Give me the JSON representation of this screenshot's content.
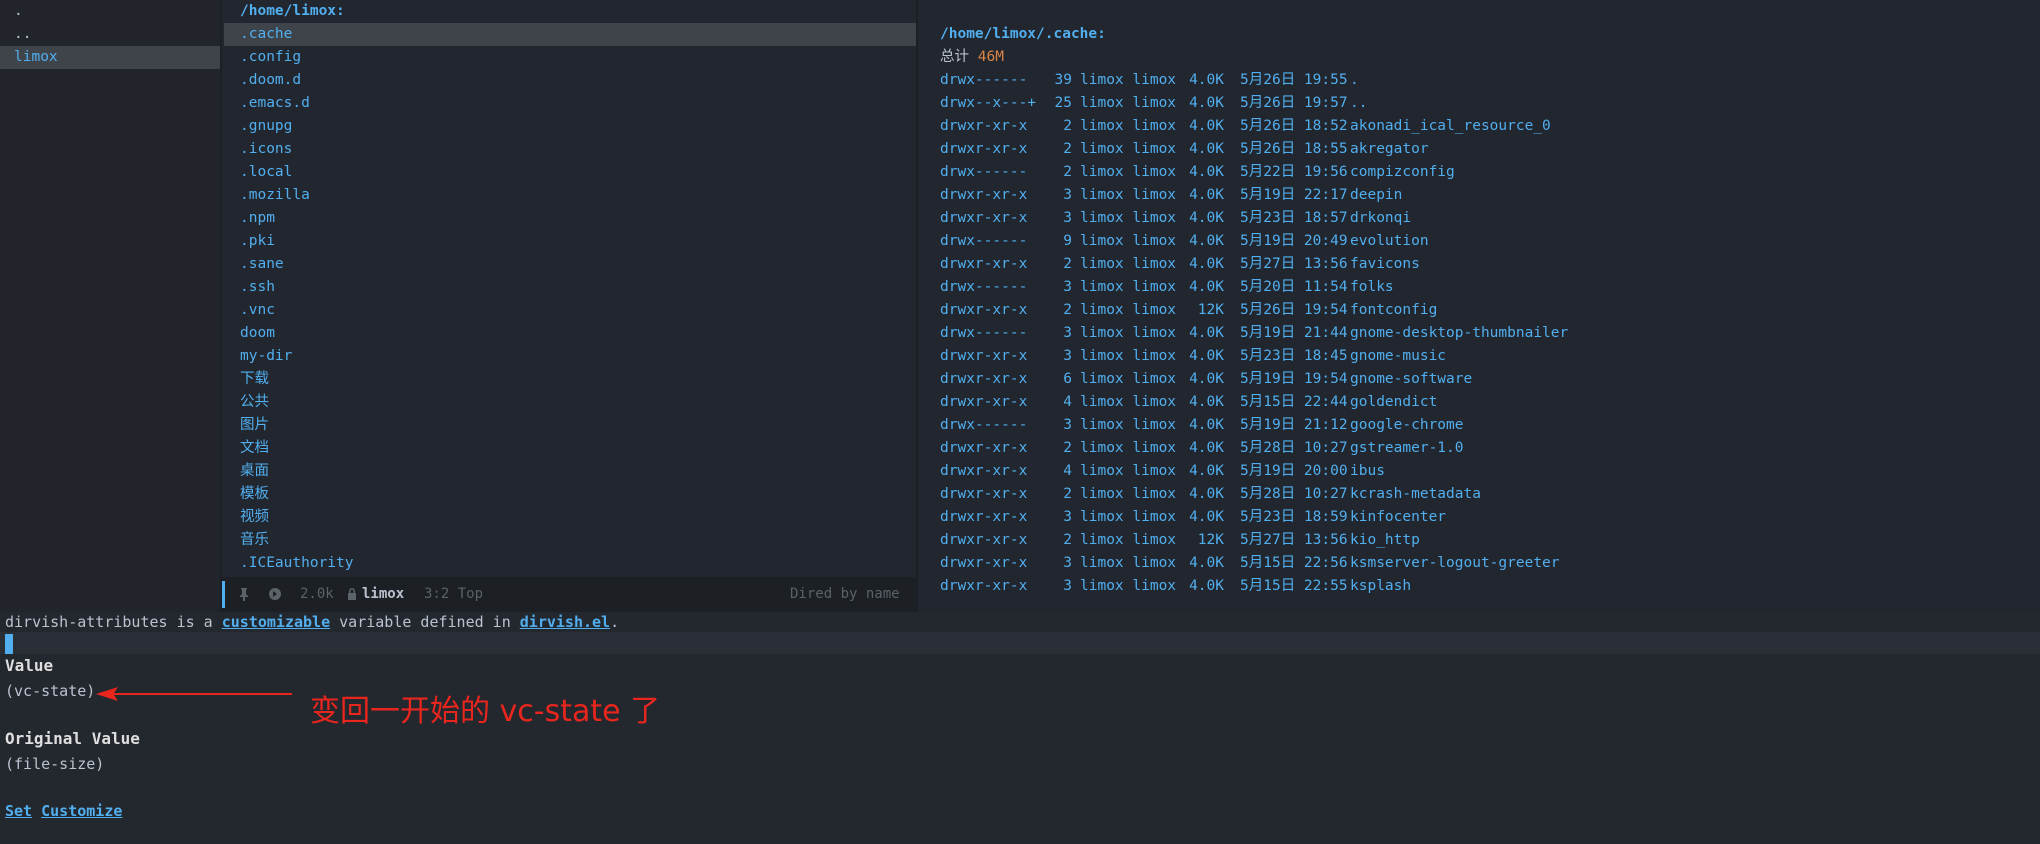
{
  "sidebar": {
    "items": [
      {
        "label": ".",
        "selected": false
      },
      {
        "label": "..",
        "selected": false
      },
      {
        "label": "limox",
        "selected": true
      }
    ]
  },
  "middle": {
    "header": "/home/limox:",
    "items": [
      ".cache",
      ".config",
      ".doom.d",
      ".emacs.d",
      ".gnupg",
      ".icons",
      ".local",
      ".mozilla",
      ".npm",
      ".pki",
      ".sane",
      ".ssh",
      ".vnc",
      "doom",
      "my-dir",
      "下载",
      "公共",
      "图片",
      "文档",
      "桌面",
      "模板",
      "视频",
      "音乐",
      ".ICEauthority"
    ],
    "selected_index": 0
  },
  "preview": {
    "header": "/home/limox/.cache:",
    "total_label": "总计",
    "total_value": "46M",
    "rows": [
      {
        "perm": "drwx------",
        "links": "39",
        "owner": "limox limox",
        "size": "4.0K",
        "date": "5月26日 19:55",
        "name": "."
      },
      {
        "perm": "drwx--x---+",
        "links": "25",
        "owner": "limox limox",
        "size": "4.0K",
        "date": "5月26日 19:57",
        "name": ".."
      },
      {
        "perm": "drwxr-xr-x",
        "links": "2",
        "owner": "limox limox",
        "size": "4.0K",
        "date": "5月26日 18:52",
        "name": "akonadi_ical_resource_0"
      },
      {
        "perm": "drwxr-xr-x",
        "links": "2",
        "owner": "limox limox",
        "size": "4.0K",
        "date": "5月26日 18:55",
        "name": "akregator"
      },
      {
        "perm": "drwx------",
        "links": "2",
        "owner": "limox limox",
        "size": "4.0K",
        "date": "5月22日 19:56",
        "name": "compizconfig"
      },
      {
        "perm": "drwxr-xr-x",
        "links": "3",
        "owner": "limox limox",
        "size": "4.0K",
        "date": "5月19日 22:17",
        "name": "deepin"
      },
      {
        "perm": "drwxr-xr-x",
        "links": "3",
        "owner": "limox limox",
        "size": "4.0K",
        "date": "5月23日 18:57",
        "name": "drkonqi"
      },
      {
        "perm": "drwx------",
        "links": "9",
        "owner": "limox limox",
        "size": "4.0K",
        "date": "5月19日 20:49",
        "name": "evolution"
      },
      {
        "perm": "drwxr-xr-x",
        "links": "2",
        "owner": "limox limox",
        "size": "4.0K",
        "date": "5月27日 13:56",
        "name": "favicons"
      },
      {
        "perm": "drwx------",
        "links": "3",
        "owner": "limox limox",
        "size": "4.0K",
        "date": "5月20日 11:54",
        "name": "folks"
      },
      {
        "perm": "drwxr-xr-x",
        "links": "2",
        "owner": "limox limox",
        "size": "12K",
        "date": "5月26日 19:54",
        "name": "fontconfig"
      },
      {
        "perm": "drwx------",
        "links": "3",
        "owner": "limox limox",
        "size": "4.0K",
        "date": "5月19日 21:44",
        "name": "gnome-desktop-thumbnailer"
      },
      {
        "perm": "drwxr-xr-x",
        "links": "3",
        "owner": "limox limox",
        "size": "4.0K",
        "date": "5月23日 18:45",
        "name": "gnome-music"
      },
      {
        "perm": "drwxr-xr-x",
        "links": "6",
        "owner": "limox limox",
        "size": "4.0K",
        "date": "5月19日 19:54",
        "name": "gnome-software"
      },
      {
        "perm": "drwxr-xr-x",
        "links": "4",
        "owner": "limox limox",
        "size": "4.0K",
        "date": "5月15日 22:44",
        "name": "goldendict"
      },
      {
        "perm": "drwx------",
        "links": "3",
        "owner": "limox limox",
        "size": "4.0K",
        "date": "5月19日 21:12",
        "name": "google-chrome"
      },
      {
        "perm": "drwxr-xr-x",
        "links": "2",
        "owner": "limox limox",
        "size": "4.0K",
        "date": "5月28日 10:27",
        "name": "gstreamer-1.0"
      },
      {
        "perm": "drwxr-xr-x",
        "links": "4",
        "owner": "limox limox",
        "size": "4.0K",
        "date": "5月19日 20:00",
        "name": "ibus"
      },
      {
        "perm": "drwxr-xr-x",
        "links": "2",
        "owner": "limox limox",
        "size": "4.0K",
        "date": "5月28日 10:27",
        "name": "kcrash-metadata"
      },
      {
        "perm": "drwxr-xr-x",
        "links": "3",
        "owner": "limox limox",
        "size": "4.0K",
        "date": "5月23日 18:59",
        "name": "kinfocenter"
      },
      {
        "perm": "drwxr-xr-x",
        "links": "2",
        "owner": "limox limox",
        "size": "12K",
        "date": "5月27日 13:56",
        "name": "kio_http"
      },
      {
        "perm": "drwxr-xr-x",
        "links": "3",
        "owner": "limox limox",
        "size": "4.0K",
        "date": "5月15日 22:56",
        "name": "ksmserver-logout-greeter"
      },
      {
        "perm": "drwxr-xr-x",
        "links": "3",
        "owner": "limox limox",
        "size": "4.0K",
        "date": "5月15日 22:55",
        "name": "ksplash"
      }
    ]
  },
  "modeline": {
    "size": "2.0k",
    "buffer": "limox",
    "position": "3:2 Top",
    "mode": "Dired by name"
  },
  "help": {
    "variable": "dirvish-attributes",
    "text_is_a": " is a ",
    "customizable_link": "customizable",
    "text_defined_in": " variable defined in ",
    "file_link": "dirvish.el",
    "period": ".",
    "value_heading": "Value",
    "value": "(vc-state)",
    "original_heading": "Original Value",
    "original_value": "(file-size)",
    "set_link": "Set",
    "customize_link": "Customize"
  },
  "annotation": {
    "text": "变回一开始的 vc-state 了",
    "color": "#e8261d"
  },
  "colors": {
    "accent": "#51afef",
    "background": "#22262e",
    "selection": "#3f444a",
    "total_value": "#da8548"
  }
}
